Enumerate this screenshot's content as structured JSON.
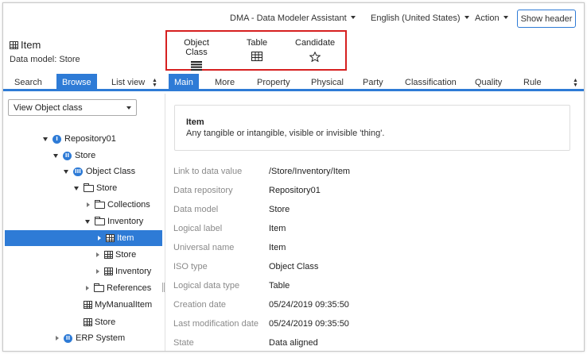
{
  "top_menu": {
    "app": "DMA - Data Modeler Assistant",
    "language": "English (United States)",
    "action": "Action",
    "show_header": "Show header"
  },
  "page": {
    "title": "Item",
    "subtitle": "Data model: Store"
  },
  "view_options": [
    {
      "label": "Object Class",
      "icon": "list-lines-icon"
    },
    {
      "label": "Table",
      "icon": "table-grid-icon"
    },
    {
      "label": "Candidate",
      "icon": "star-outline-icon"
    }
  ],
  "left_tabs": [
    "Search",
    "Browse",
    "List view"
  ],
  "left_active_tab": "Browse",
  "right_tabs": [
    "Main",
    "More",
    "Property",
    "Physical",
    "Party",
    "Classification",
    "Quality",
    "Rule"
  ],
  "right_active_tab": "Main",
  "view_select": "View Object class",
  "tree": [
    {
      "label": "Repository01",
      "badge": "I"
    },
    {
      "label": "Store",
      "badge": "II"
    },
    {
      "label": "Object Class",
      "badge": "III"
    },
    {
      "label": "Store"
    },
    {
      "label": "Collections"
    },
    {
      "label": "Inventory"
    },
    {
      "label": "Item"
    },
    {
      "label": "Store"
    },
    {
      "label": "Inventory"
    },
    {
      "label": "References"
    },
    {
      "label": "MyManualItem"
    },
    {
      "label": "Store"
    },
    {
      "label": "ERP System"
    }
  ],
  "description": {
    "heading": "Item",
    "text": "Any tangible or intangible, visible or invisible 'thing'."
  },
  "properties": [
    {
      "label": "Link to data value",
      "value": "/Store/Inventory/Item"
    },
    {
      "label": "Data repository",
      "value": "Repository01"
    },
    {
      "label": "Data model",
      "value": "Store"
    },
    {
      "label": "Logical label",
      "value": "Item"
    },
    {
      "label": "Universal name",
      "value": "Item"
    },
    {
      "label": "ISO type",
      "value": "Object Class"
    },
    {
      "label": "Logical data type",
      "value": "Table"
    },
    {
      "label": "Creation date",
      "value": "05/24/2019 09:35:50"
    },
    {
      "label": "Last modification date",
      "value": "05/24/2019 09:35:50"
    },
    {
      "label": "State",
      "value": "Data aligned"
    }
  ],
  "colors": {
    "accent": "#2e7bd6",
    "highlight_box": "#d62020"
  }
}
